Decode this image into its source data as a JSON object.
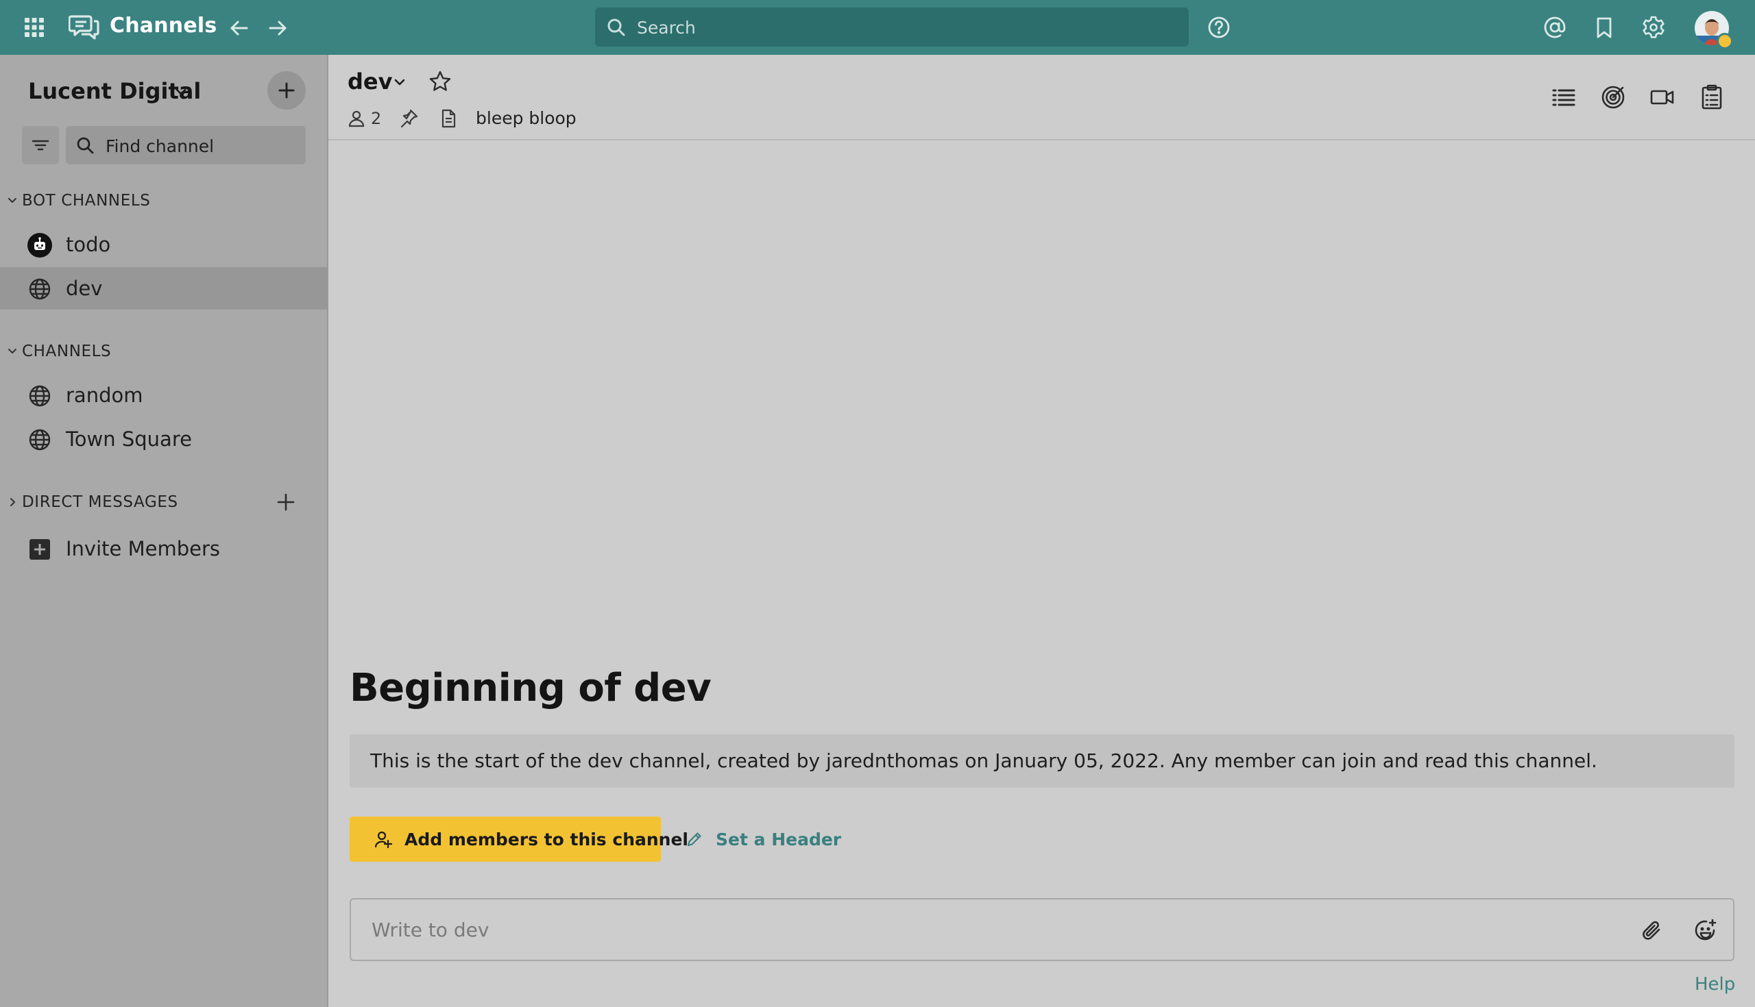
{
  "topbar": {
    "app_title": "Channels",
    "search_placeholder": "Search",
    "bg_color": "#3a8380",
    "status_color": "#f3c13a"
  },
  "sidebar": {
    "team_name": "Lucent Digital",
    "find_channel_placeholder": "Find channel",
    "categories": [
      {
        "label": "BOT CHANNELS",
        "items": [
          {
            "name": "todo",
            "icon": "bot-icon",
            "active": false
          },
          {
            "name": "dev",
            "icon": "globe-icon",
            "active": true
          }
        ]
      },
      {
        "label": "CHANNELS",
        "items": [
          {
            "name": "random",
            "icon": "globe-icon",
            "active": false
          },
          {
            "name": "Town Square",
            "icon": "globe-icon",
            "active": false
          }
        ]
      },
      {
        "label": "DIRECT MESSAGES",
        "items": [
          {
            "name": "Invite Members",
            "icon": "plus-box-icon",
            "active": false
          }
        ]
      }
    ]
  },
  "channel": {
    "name": "dev",
    "member_count": "2",
    "purpose": "bleep bloop"
  },
  "intro": {
    "title": "Beginning of dev",
    "description": "This is the start of the dev channel, created by jarednthomas on January 05, 2022. Any member can join and read this channel.",
    "add_members_label": "Add members to this channel",
    "set_header_label": "Set a Header",
    "button_color": "#f2c232"
  },
  "composer": {
    "placeholder": "Write to dev",
    "help_label": "Help"
  }
}
